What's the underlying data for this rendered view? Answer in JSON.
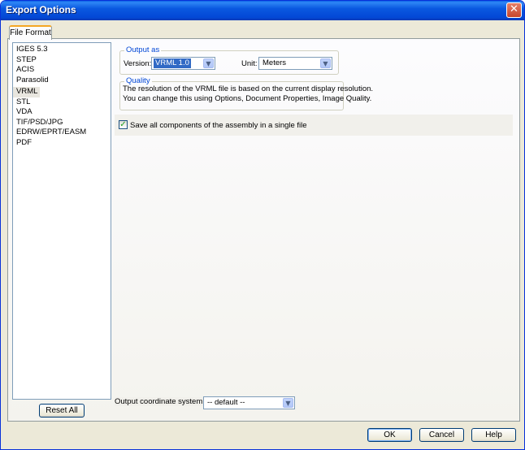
{
  "window": {
    "title": "Export Options",
    "close_glyph": "✕"
  },
  "tabs": [
    {
      "label": "File Format",
      "active": true
    }
  ],
  "formats": {
    "items": [
      "IGES 5.3",
      "STEP",
      "ACIS",
      "Parasolid",
      "VRML",
      "STL",
      "VDA",
      "TIF/PSD/JPG",
      "EDRW/EPRT/EASM",
      "PDF"
    ],
    "selected": "VRML"
  },
  "reset_all_label": "Reset All",
  "output_as": {
    "title": "Output as",
    "version_label": "Version:",
    "version_value": "VRML 1.0",
    "unit_label": "Unit:",
    "unit_value": "Meters"
  },
  "quality": {
    "title": "Quality",
    "line1": "The resolution of the VRML file is based on the current display resolution.",
    "line2": "You can change this using Options, Document Properties, Image Quality."
  },
  "single_file": {
    "label": "Save all components of the assembly in a single file",
    "checked": true
  },
  "coordinate_system": {
    "label": "Output coordinate system:",
    "value": "-- default --"
  },
  "footer": {
    "ok_label": "OK",
    "cancel_label": "Cancel",
    "help_label": "Help"
  },
  "icons": {
    "close": "close-icon",
    "dropdown": "chevron-down-icon",
    "check": "check-icon"
  },
  "colors": {
    "titlebar": "#0a58e0",
    "group_title": "#0046d5",
    "selection": "#316ac5",
    "tab_highlight": "#f5a623"
  }
}
